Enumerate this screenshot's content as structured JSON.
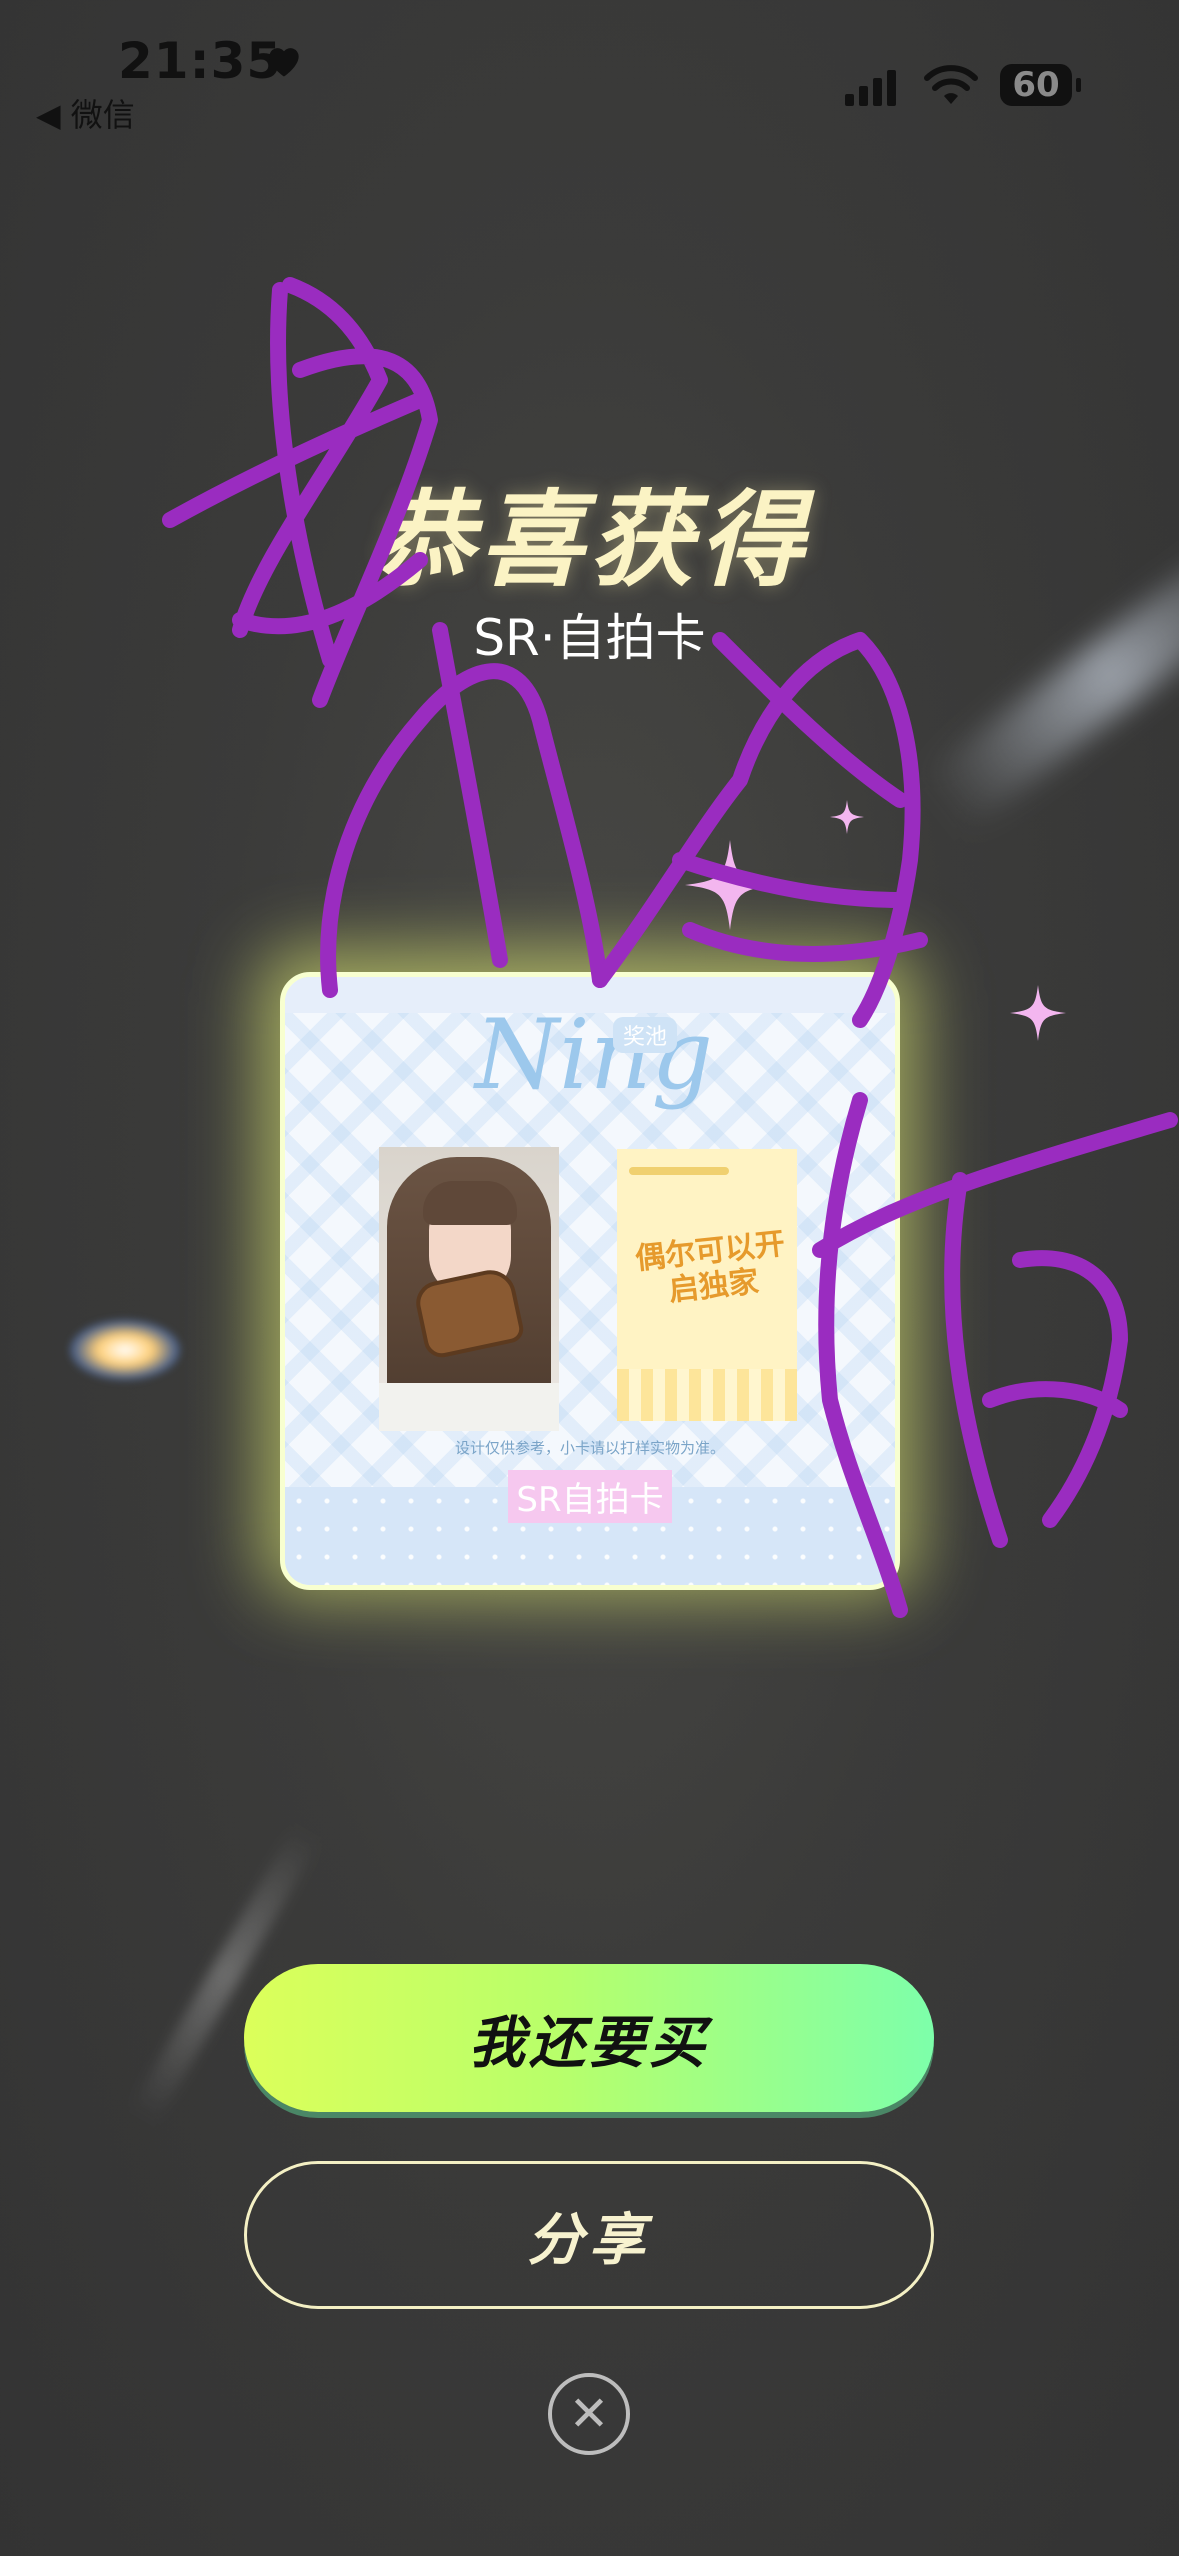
{
  "status_bar": {
    "time": "21:35",
    "back_label": "◀ 微信",
    "battery": "60",
    "icons": [
      "heart-icon",
      "signal-icon",
      "wifi-icon",
      "battery-icon"
    ]
  },
  "reward": {
    "title": "恭喜获得",
    "subtitle": "SR·自拍卡"
  },
  "card": {
    "logo_text": "Ning",
    "pool_tag": "奖池",
    "notice": "设计仅供参考，小卡请以打样实物为准。",
    "flyer_text": "偶尔可以开启独家",
    "label": "SR自拍卡"
  },
  "actions": {
    "buy_again": "我还要买",
    "share": "分享",
    "close_icon": "close-icon"
  },
  "colors": {
    "title": "#fbf3c4",
    "button_gradient_start": "#dcff5a",
    "button_gradient_end": "#7dffaa",
    "scribble": "#9a2cc0",
    "card_glow": "#f2ff78"
  }
}
